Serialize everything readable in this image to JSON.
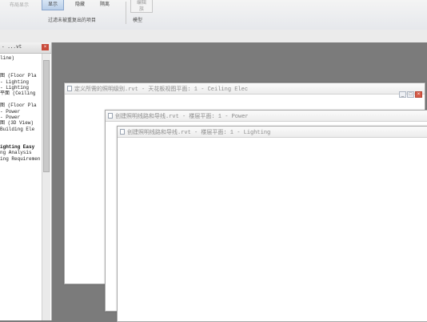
{
  "ribbon": {
    "faded_label": "布局显示",
    "show_label": "显示",
    "hide_label": "隐藏",
    "isolate_label": "隔离",
    "edit_label": "编辑",
    "edit_label2": "族",
    "group1_label": "过滤未被重复出的项目",
    "group2_label": "模型"
  },
  "browser": {
    "title": "- ...vt",
    "items": [
      "line)",
      "",
      "",
      "图 (Floor Pla",
      "- Lighting",
      "- Lighting",
      "平面 (Ceiling",
      "",
      "图 (Floor Pla",
      "- Power",
      "- Power",
      "图 (3D View)",
      "Building Ele",
      "",
      "",
      "ighting Easy",
      "ng Analysis",
      "ing Requiremen"
    ],
    "bold_index": 15
  },
  "windows": [
    {
      "title": "定义所需的照明级别.rvt - 天花板视图平面: 1 - Ceiling Elec"
    },
    {
      "title": "创建照明线路和导线.rvt - 楼层平面: 1 - Power"
    },
    {
      "title": "创建照明线路和导线.rvt - 楼层平面: 1 - Lighting"
    }
  ],
  "icons": {
    "window_controls": [
      "minimize-icon",
      "restore-icon",
      "close-icon"
    ],
    "doc_icon": "document-icon"
  }
}
